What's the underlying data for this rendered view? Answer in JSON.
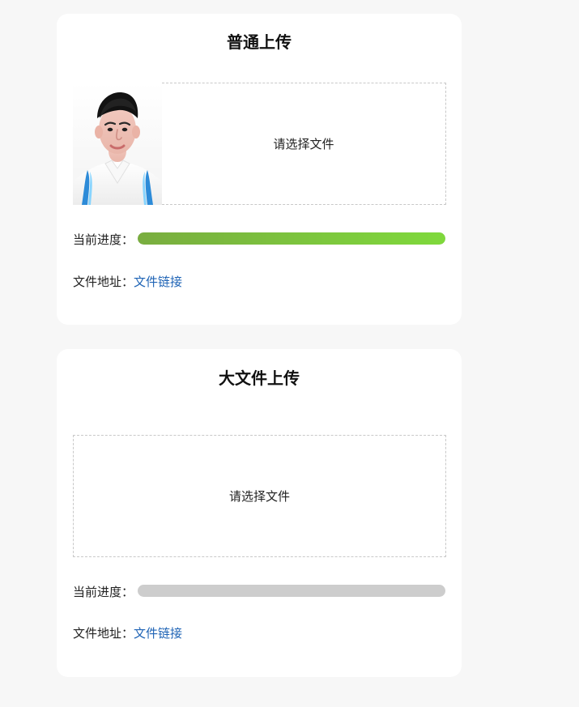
{
  "sections": {
    "normal": {
      "title": "普通上传",
      "dropzone_text": "请选择文件",
      "progress_label": "当前进度：",
      "progress_value": 1.0,
      "address_label": "文件地址：",
      "address_link_text": "文件链接",
      "has_thumbnail": true
    },
    "large": {
      "title": "大文件上传",
      "dropzone_text": "请选择文件",
      "progress_label": "当前进度：",
      "progress_value": 0.0,
      "address_label": "文件地址：",
      "address_link_text": "文件链接",
      "has_thumbnail": false
    }
  },
  "colors": {
    "page_bg": "#f7f7f7",
    "card_bg": "#ffffff",
    "progress_track": "#cdcdcd",
    "progress_fill_start": "#79ad3f",
    "progress_fill_end": "#7fd93c",
    "link": "#1e63b5",
    "dropzone_border": "#c8c8c8"
  }
}
